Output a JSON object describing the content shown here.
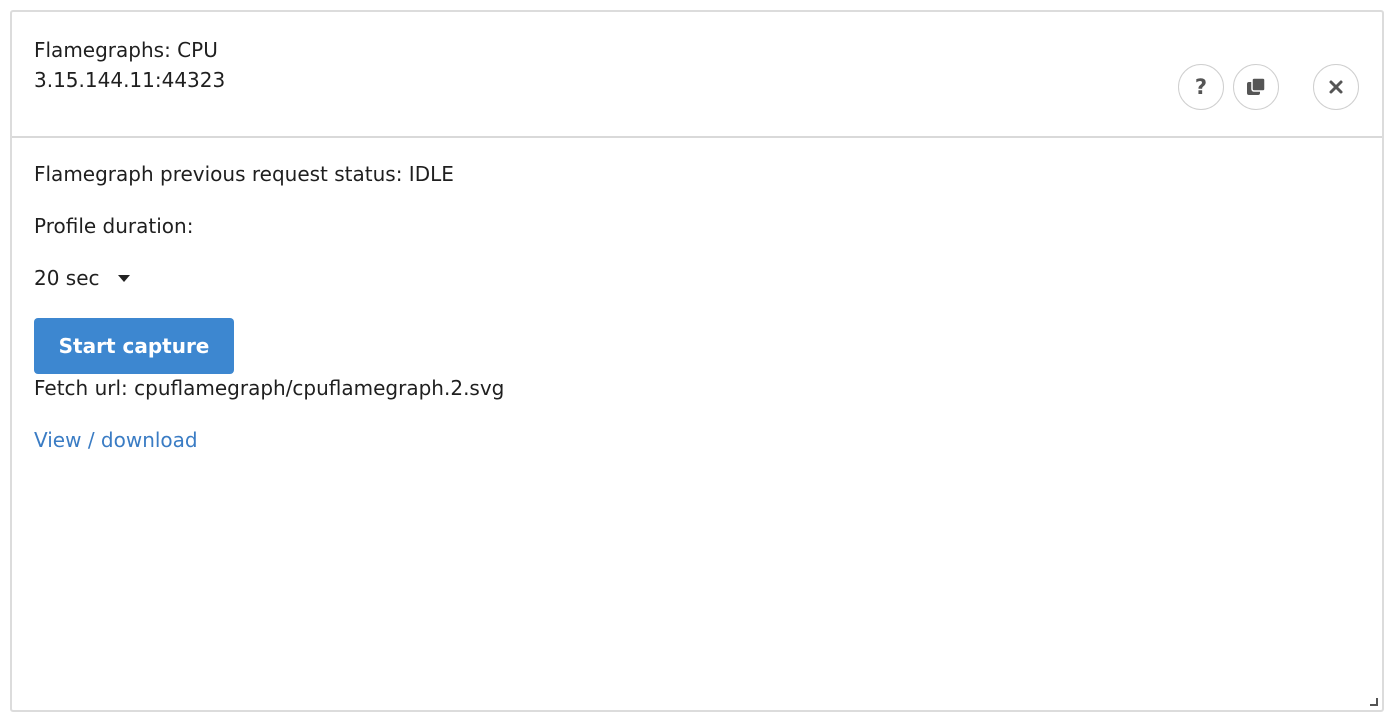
{
  "header": {
    "title": "Flamegraphs: CPU",
    "subtitle": "3.15.144.11:44323",
    "buttons": {
      "help_icon": "question-mark-icon",
      "copy_icon": "copy-icon",
      "close_icon": "close-icon"
    }
  },
  "body": {
    "status_text": "Flamegraph previous request status: IDLE",
    "duration_label": "Profile duration:",
    "duration_select": {
      "selected": "20 sec"
    },
    "start_button_label": "Start capture",
    "fetch_url_text": "Fetch url: cpuflamegraph/cpuflamegraph.2.svg",
    "view_link_label": "View / download"
  },
  "colors": {
    "primary_button": "#3d87d0",
    "link": "#3a7cc4",
    "border": "#dcdcdc"
  }
}
